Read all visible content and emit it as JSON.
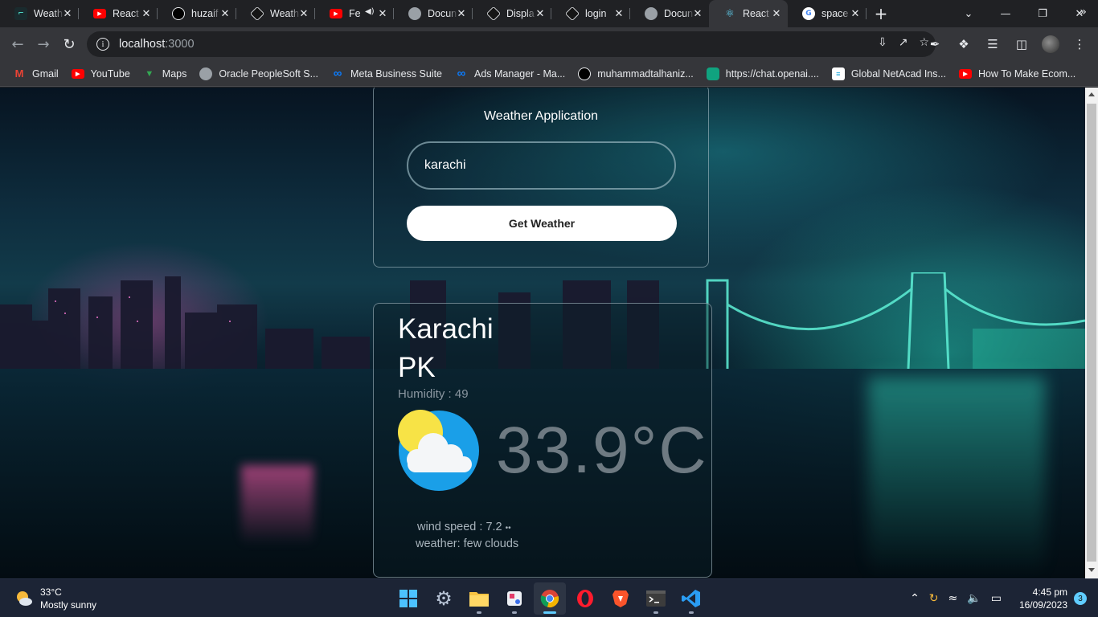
{
  "browser": {
    "tabs": [
      {
        "title": "Weath",
        "icon": "app-icon",
        "color": "#1a2b2e"
      },
      {
        "title": "React",
        "icon": "youtube-icon",
        "color": "#ff0000"
      },
      {
        "title": "huzaif",
        "icon": "github-icon",
        "color": "#000000"
      },
      {
        "title": "Weath",
        "icon": "codesandbox-icon",
        "color": "#151515"
      },
      {
        "title": "Fe",
        "icon": "youtube-icon",
        "color": "#ff0000"
      },
      {
        "title": "Docun",
        "icon": "globe-icon",
        "color": "#5f6368"
      },
      {
        "title": "Displa",
        "icon": "codesandbox-icon",
        "color": "#151515"
      },
      {
        "title": "login",
        "icon": "codesandbox-icon",
        "color": "#151515"
      },
      {
        "title": "Docun",
        "icon": "globe-icon",
        "color": "#5f6368"
      },
      {
        "title": "React",
        "icon": "react-icon",
        "color": "#35363a"
      },
      {
        "title": "space",
        "icon": "google-icon",
        "color": "#ffffff"
      }
    ],
    "active_tab_index": 9,
    "address": {
      "host": "localhost",
      "port": ":3000"
    }
  },
  "bookmarks": [
    {
      "label": "Gmail",
      "icon": "gmail-icon",
      "color": "#ea4335"
    },
    {
      "label": "YouTube",
      "icon": "youtube-icon",
      "color": "#ff0000"
    },
    {
      "label": "Maps",
      "icon": "maps-icon",
      "color": "#34a853"
    },
    {
      "label": "Oracle PeopleSoft S...",
      "icon": "globe-icon",
      "color": "#5f6368"
    },
    {
      "label": "Meta Business Suite",
      "icon": "meta-icon",
      "color": "#0a7cff"
    },
    {
      "label": "Ads Manager - Ma...",
      "icon": "meta-icon",
      "color": "#0a7cff"
    },
    {
      "label": "muhammadtalhaniz...",
      "icon": "github-icon",
      "color": "#000000"
    },
    {
      "label": "https://chat.openai....",
      "icon": "openai-icon",
      "color": "#10a37f"
    },
    {
      "label": "Global NetAcad Ins...",
      "icon": "cisco-icon",
      "color": "#ffffff"
    },
    {
      "label": "How To Make Ecom...",
      "icon": "youtube-icon",
      "color": "#ff0000"
    }
  ],
  "app": {
    "title": "Weather Application",
    "search": {
      "value": "karachi",
      "placeholder": ""
    },
    "button_label": "Get Weather",
    "result": {
      "city": "Karachi",
      "country": "PK",
      "humidity": "Humidity : 49",
      "temperature": "33.9°C",
      "wind": "wind speed : 7.2",
      "weather": "weather: few clouds",
      "icon": "partly-cloudy-icon"
    }
  },
  "taskbar": {
    "weather_temp": "33°C",
    "weather_desc": "Mostly sunny",
    "time": "4:45 pm",
    "date": "16/09/2023",
    "notification_count": "3"
  }
}
